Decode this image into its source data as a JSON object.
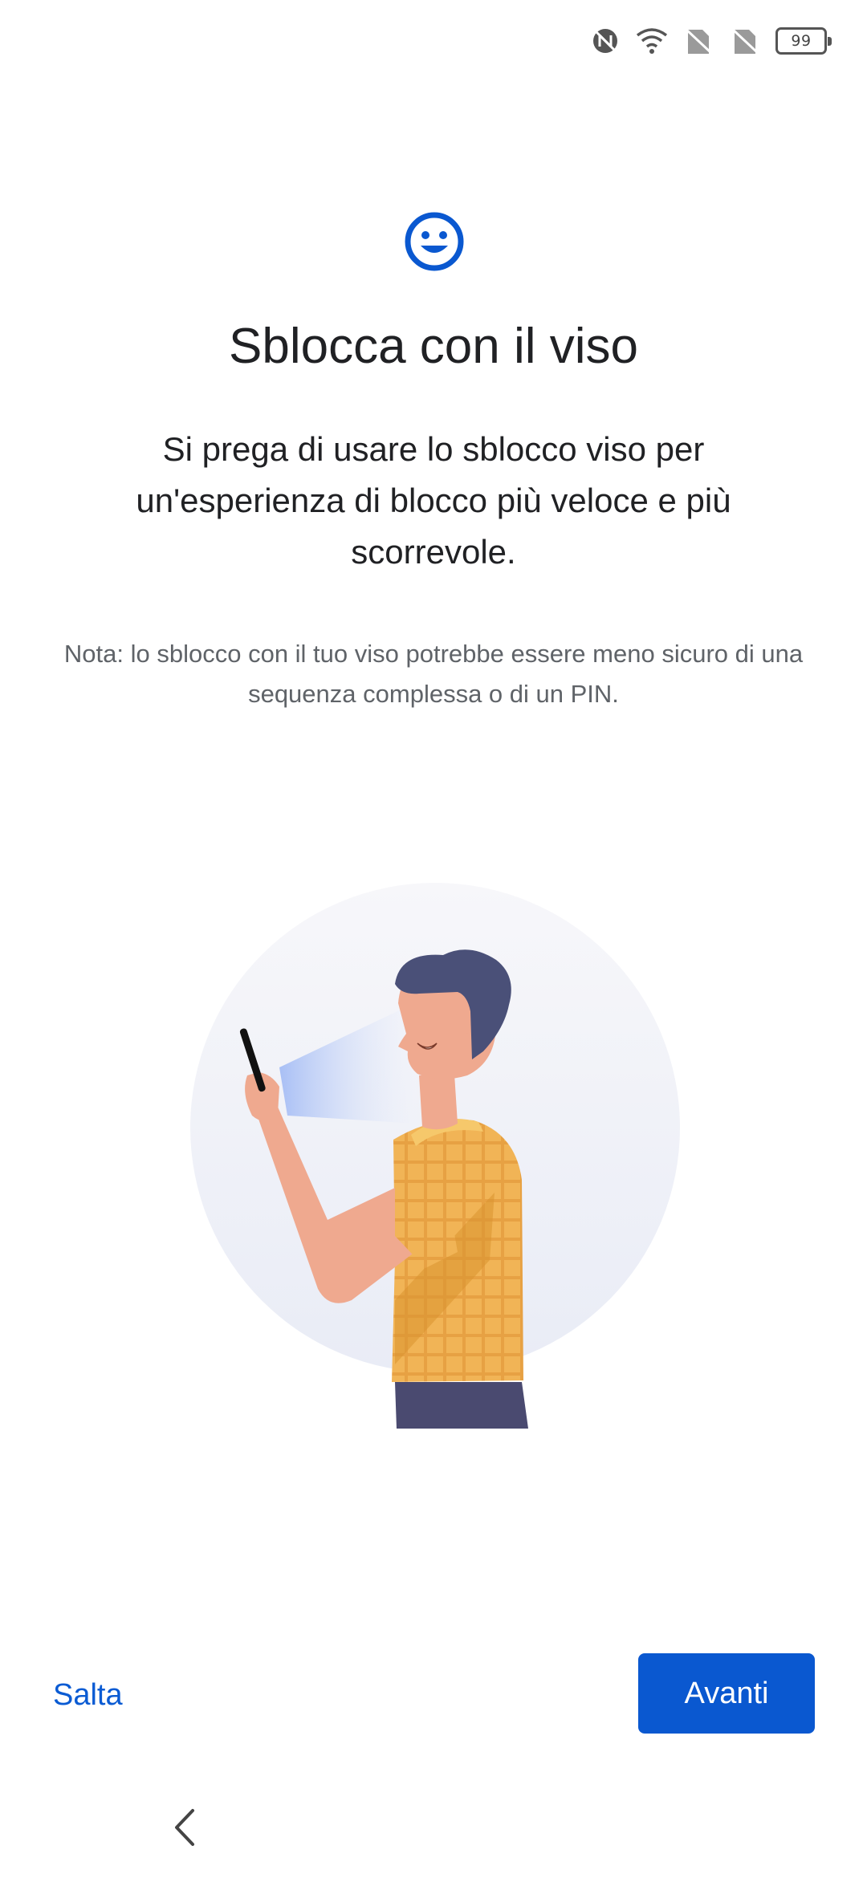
{
  "status_bar": {
    "icons": [
      "nfc-icon",
      "wifi-icon",
      "no-sim-icon",
      "no-sim-icon"
    ],
    "battery_level": "99"
  },
  "header": {
    "icon": "smiley-face-icon",
    "title": "Sblocca con il viso"
  },
  "content": {
    "description": "Si prega di usare lo sblocco viso per un'esperienza di blocco più veloce e più scorrevole.",
    "note": "Nota: lo sblocco con il tuo viso potrebbe essere meno sicuro di una sequenza complessa o di un PIN.",
    "illustration": "person-face-unlock-illustration"
  },
  "footer": {
    "skip_label": "Salta",
    "next_label": "Avanti"
  },
  "nav": {
    "back_icon": "chevron-left-icon"
  },
  "colors": {
    "accent": "#0a58d0",
    "title_text": "#202124",
    "secondary_text": "#5f6368",
    "shirt": "#f0b050",
    "hair": "#4a5078",
    "skin": "#efa98f"
  }
}
